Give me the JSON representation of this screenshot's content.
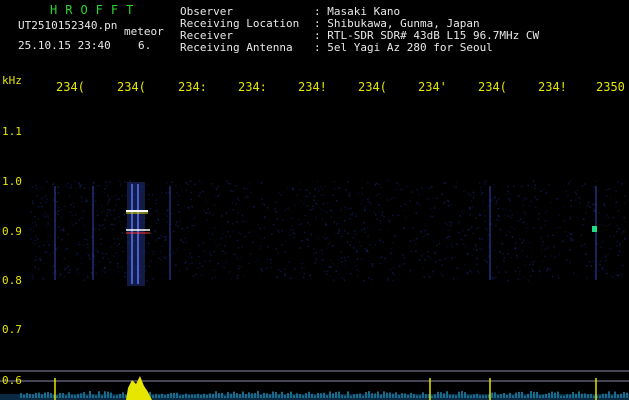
{
  "header": {
    "app_name": "HROFFT",
    "filename": "UT2510152340.pn",
    "mode": "meteor",
    "datetime": "25.10.15 23:40",
    "count": "6.",
    "fields": [
      {
        "label": "Observer",
        "value": ": Masaki Kano"
      },
      {
        "label": "Receiving Location",
        "value": ": Shibukawa, Gunma, Japan"
      },
      {
        "label": "Receiver",
        "value": ": RTL-SDR SDR# 43dB L15 96.7MHz CW"
      },
      {
        "label": "Receiving Antenna",
        "value": ": 5el Yagi Az 280 for Seoul"
      }
    ]
  },
  "y_axis": {
    "unit": "kHz",
    "ticks": [
      "1.1",
      "1.0",
      "0.9",
      "0.8",
      "0.7",
      "0.6"
    ]
  },
  "time_axis": {
    "ticks": [
      "234(",
      "234(",
      "234:",
      "234:",
      "234!",
      "234(",
      "234'",
      "234(",
      "234!",
      "2350"
    ]
  },
  "colors": {
    "background": "#000000",
    "header_text": "#e8e8e8",
    "title_text": "#2bd62b",
    "axis_text": "#e6e600",
    "signal": "#e6e600",
    "noise": "#1a2a8a"
  }
}
